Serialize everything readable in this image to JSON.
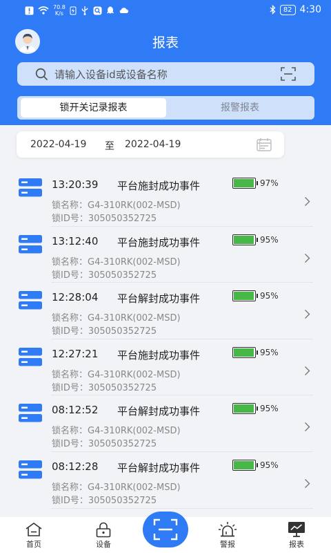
{
  "status_bar": {
    "net_speed_value": "70.8",
    "net_speed_unit": "K/s",
    "battery": "82",
    "time": "4:30"
  },
  "header": {
    "title": "报表"
  },
  "search": {
    "placeholder": "请输入设备id或设备名称"
  },
  "tabs": [
    {
      "label": "锁开关记录报表",
      "active": true
    },
    {
      "label": "报警报表",
      "active": false
    }
  ],
  "date_range": {
    "start": "2022-04-19",
    "separator": "至",
    "end": "2022-04-19"
  },
  "records": [
    {
      "time": "13:20:39",
      "event": "平台施封成功事件",
      "battery_pct": "97%",
      "battery_level": 0.97,
      "lock_name": "锁名称：G4-310RK(002-MSD)",
      "lock_id": "锁ID号：305050352725"
    },
    {
      "time": "13:12:40",
      "event": "平台施封成功事件",
      "battery_pct": "95%",
      "battery_level": 0.95,
      "lock_name": "锁名称：G4-310RK(002-MSD)",
      "lock_id": "锁ID号：305050352725"
    },
    {
      "time": "12:28:04",
      "event": "平台解封成功事件",
      "battery_pct": "95%",
      "battery_level": 0.95,
      "lock_name": "锁名称：G4-310RK(002-MSD)",
      "lock_id": "锁ID号：305050352725"
    },
    {
      "time": "12:27:21",
      "event": "平台施封成功事件",
      "battery_pct": "95%",
      "battery_level": 0.95,
      "lock_name": "锁名称：G4-310RK(002-MSD)",
      "lock_id": "锁ID号：305050352725"
    },
    {
      "time": "08:12:52",
      "event": "平台解封成功事件",
      "battery_pct": "95%",
      "battery_level": 0.95,
      "lock_name": "锁名称：G4-310RK(002-MSD)",
      "lock_id": "锁ID号：305050352725"
    },
    {
      "time": "08:12:28",
      "event": "平台解封成功事件",
      "battery_pct": "95%",
      "battery_level": 0.95,
      "lock_name": "锁名称：G4-310RK(002-MSD)",
      "lock_id": "锁ID号：305050352725"
    }
  ],
  "nav": {
    "home": "首页",
    "devices": "设备",
    "alarm": "警报",
    "report": "报表"
  },
  "colors": {
    "primary": "#2f7bf5",
    "battery_fill": "#47b747",
    "icon_blue": "#2f7bf5"
  },
  "icons": [
    "alert-icon",
    "wifi-icon",
    "charge-icon",
    "usb-icon",
    "search-app-icon",
    "qq-icon",
    "cloud-icon",
    "bluetooth-icon",
    "avatar-icon",
    "search-icon",
    "scan-icon",
    "calendar-icon",
    "server-icon",
    "battery-icon",
    "chevron-right-icon",
    "home-icon",
    "lock-icon",
    "siren-icon",
    "monitor-chart-icon"
  ]
}
